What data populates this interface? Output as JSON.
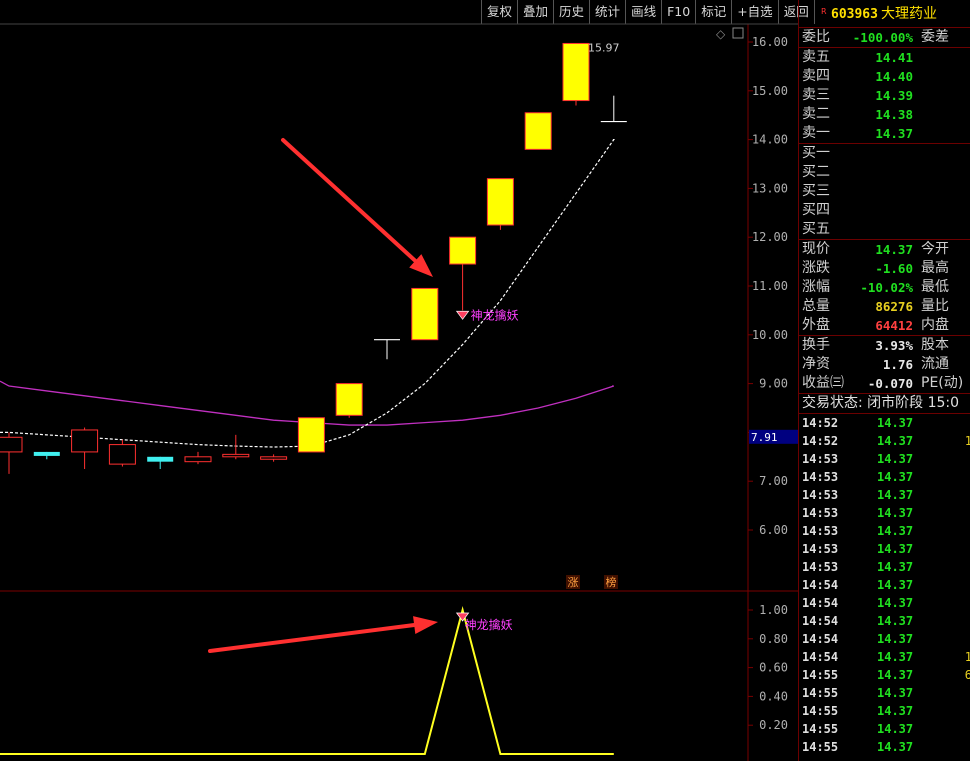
{
  "toolbar": [
    "复权",
    "叠加",
    "历史",
    "统计",
    "画线",
    "F10",
    "标记",
    "+自选",
    "返回"
  ],
  "stock": {
    "mark": "R",
    "code": "603963",
    "name": "大理药业"
  },
  "quote": {
    "wei_bi_label": "委比",
    "wei_bi": "-100.00%",
    "wei_cha_label": "委差",
    "asks": [
      {
        "label": "卖五",
        "price": "14.41"
      },
      {
        "label": "卖四",
        "price": "14.40"
      },
      {
        "label": "卖三",
        "price": "14.39"
      },
      {
        "label": "卖二",
        "price": "14.38"
      },
      {
        "label": "卖一",
        "price": "14.37"
      }
    ],
    "bids": [
      {
        "label": "买一",
        "price": ""
      },
      {
        "label": "买二",
        "price": ""
      },
      {
        "label": "买三",
        "price": ""
      },
      {
        "label": "买四",
        "price": ""
      },
      {
        "label": "买五",
        "price": ""
      }
    ],
    "stats": [
      {
        "label": "现价",
        "value": "14.37",
        "color": "green",
        "label2": "今开"
      },
      {
        "label": "涨跌",
        "value": "-1.60",
        "color": "green",
        "label2": "最高"
      },
      {
        "label": "涨幅",
        "value": "-10.02%",
        "color": "green",
        "label2": "最低"
      },
      {
        "label": "总量",
        "value": "86276",
        "color": "yellow",
        "label2": "量比"
      },
      {
        "label": "外盘",
        "value": "64412",
        "color": "red",
        "label2": "内盘"
      }
    ],
    "fin": [
      {
        "label": "换手",
        "value": "3.93%",
        "label2": "股本"
      },
      {
        "label": "净资",
        "value": "1.76",
        "label2": "流通"
      },
      {
        "label": "收益㈢",
        "value": "-0.070",
        "label2": "PE(动)"
      }
    ],
    "trade_status": "交易状态: 闭市阶段 15:0"
  },
  "ticks": [
    {
      "time": "14:52",
      "price": "14.37",
      "vol": ""
    },
    {
      "time": "14:52",
      "price": "14.37",
      "vol": "1"
    },
    {
      "time": "14:53",
      "price": "14.37",
      "vol": ""
    },
    {
      "time": "14:53",
      "price": "14.37",
      "vol": ""
    },
    {
      "time": "14:53",
      "price": "14.37",
      "vol": ""
    },
    {
      "time": "14:53",
      "price": "14.37",
      "vol": ""
    },
    {
      "time": "14:53",
      "price": "14.37",
      "vol": ""
    },
    {
      "time": "14:53",
      "price": "14.37",
      "vol": ""
    },
    {
      "time": "14:53",
      "price": "14.37",
      "vol": ""
    },
    {
      "time": "14:54",
      "price": "14.37",
      "vol": ""
    },
    {
      "time": "14:54",
      "price": "14.37",
      "vol": ""
    },
    {
      "time": "14:54",
      "price": "14.37",
      "vol": ""
    },
    {
      "time": "14:54",
      "price": "14.37",
      "vol": ""
    },
    {
      "time": "14:54",
      "price": "14.37",
      "vol": "1"
    },
    {
      "time": "14:55",
      "price": "14.37",
      "vol": "6"
    },
    {
      "time": "14:55",
      "price": "14.37",
      "vol": ""
    },
    {
      "time": "14:55",
      "price": "14.37",
      "vol": ""
    },
    {
      "time": "14:55",
      "price": "14.37",
      "vol": ""
    },
    {
      "time": "14:55",
      "price": "14.37",
      "vol": ""
    }
  ],
  "chart_data": {
    "type": "candlestick",
    "price_axis_ticks": [
      "16.00",
      "15.00",
      "14.00",
      "13.00",
      "12.00",
      "11.00",
      "10.00",
      "9.00",
      "8.00",
      "7.00",
      "6.00"
    ],
    "indicator_axis_ticks": [
      "1.00",
      "0.80",
      "0.60",
      "0.40",
      "0.20"
    ],
    "high_label": "15.97",
    "current_marker": "7.91",
    "signal_label": "神龙擒妖",
    "tags": [
      "涨",
      "榜"
    ],
    "candles": [
      {
        "o": 7.6,
        "c": 7.9,
        "h": 8.0,
        "l": 7.15,
        "color": "red"
      },
      {
        "o": 7.6,
        "c": 7.55,
        "h": 7.6,
        "l": 7.45,
        "color": "cyan"
      },
      {
        "o": 7.6,
        "c": 8.05,
        "h": 8.1,
        "l": 7.25,
        "color": "red"
      },
      {
        "o": 7.35,
        "c": 7.75,
        "h": 7.85,
        "l": 7.3,
        "color": "red"
      },
      {
        "o": 7.5,
        "c": 7.4,
        "h": 7.5,
        "l": 7.25,
        "color": "cyan"
      },
      {
        "o": 7.4,
        "c": 7.5,
        "h": 7.6,
        "l": 7.35,
        "color": "red"
      },
      {
        "o": 7.5,
        "c": 7.55,
        "h": 7.95,
        "l": 7.45,
        "color": "red"
      },
      {
        "o": 7.45,
        "c": 7.5,
        "h": 7.55,
        "l": 7.4,
        "color": "red"
      },
      {
        "o": 7.6,
        "c": 8.3,
        "h": 8.3,
        "l": 7.6,
        "color": "yellow"
      },
      {
        "o": 8.35,
        "c": 9.0,
        "h": 9.0,
        "l": 8.3,
        "color": "yellow"
      },
      {
        "o": 9.9,
        "c": 9.9,
        "h": 9.9,
        "l": 9.5,
        "color": "doji"
      },
      {
        "o": 9.9,
        "c": 10.95,
        "h": 10.95,
        "l": 9.9,
        "color": "yellow"
      },
      {
        "o": 11.45,
        "c": 12.0,
        "h": 12.0,
        "l": 10.5,
        "color": "yellow"
      },
      {
        "o": 12.25,
        "c": 13.2,
        "h": 13.2,
        "l": 12.15,
        "color": "yellow"
      },
      {
        "o": 13.8,
        "c": 14.55,
        "h": 14.55,
        "l": 13.8,
        "color": "yellow"
      },
      {
        "o": 14.8,
        "c": 15.97,
        "h": 15.97,
        "l": 14.7,
        "color": "yellow"
      },
      {
        "o": 14.37,
        "c": 14.37,
        "h": 14.9,
        "l": 14.37,
        "color": "doji"
      }
    ],
    "ma_white": [
      8.0,
      7.95,
      7.9,
      7.85,
      7.8,
      7.75,
      7.72,
      7.7,
      7.72,
      7.95,
      8.4,
      9.0,
      9.8,
      10.7,
      11.8,
      12.9,
      14.0
    ],
    "ma_purple": [
      8.95,
      8.85,
      8.75,
      8.65,
      8.55,
      8.45,
      8.35,
      8.25,
      8.2,
      8.15,
      8.15,
      8.2,
      8.25,
      8.35,
      8.5,
      8.7,
      8.95
    ],
    "indicator": [
      0,
      0,
      0,
      0,
      0,
      0,
      0,
      0,
      0,
      0,
      0,
      0,
      1,
      0,
      0,
      0,
      0
    ]
  }
}
